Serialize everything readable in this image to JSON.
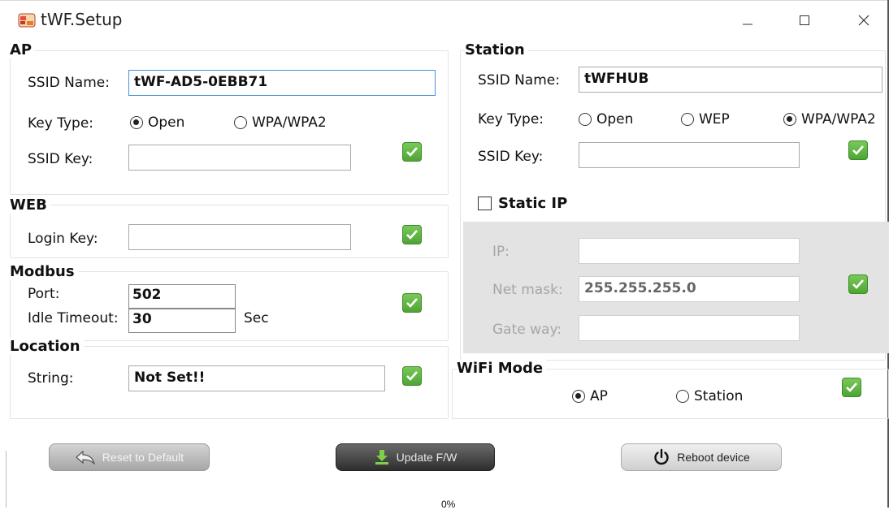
{
  "window": {
    "title": "tWF.Setup"
  },
  "ap": {
    "title": "AP",
    "ssid_name_label": "SSID Name:",
    "ssid_name_value": "tWF-AD5-0EBB71",
    "key_type_label": "Key Type:",
    "key_type_options": [
      "Open",
      "WPA/WPA2"
    ],
    "key_type_selected": "Open",
    "ssid_key_label": "SSID Key:",
    "ssid_key_value": ""
  },
  "web": {
    "title": "WEB",
    "login_key_label": "Login Key:",
    "login_key_value": ""
  },
  "modbus": {
    "title": "Modbus",
    "port_label": "Port:",
    "port_value": "502",
    "idle_label": "Idle Timeout:",
    "idle_value": "30",
    "idle_unit": "Sec"
  },
  "location": {
    "title": "Location",
    "string_label": "String:",
    "string_value": "Not Set!!"
  },
  "station": {
    "title": "Station",
    "ssid_name_label": "SSID Name:",
    "ssid_name_value": "tWFHUB",
    "key_type_label": "Key Type:",
    "key_type_options": [
      "Open",
      "WEP",
      "WPA/WPA2"
    ],
    "key_type_selected": "WPA/WPA2",
    "ssid_key_label": "SSID Key:",
    "ssid_key_value": "",
    "static_ip_label": "Static IP",
    "static_ip_checked": false,
    "ip_label": "IP:",
    "ip_value": "",
    "netmask_label": "Net mask:",
    "netmask_value": "255.255.255.0",
    "gateway_label": "Gate way:",
    "gateway_value": ""
  },
  "wifi_mode": {
    "title": "WiFi Mode",
    "options": [
      "AP",
      "Station"
    ],
    "selected": "AP"
  },
  "buttons": {
    "reset": "Reset to Default",
    "update": "Update F/W",
    "reboot": "Reboot device"
  },
  "progress": {
    "text": "0%",
    "value": 0
  },
  "colors": {
    "check_green": "#5bb43c",
    "panel_gray": "#e3e3e3",
    "focus_blue": "#4a90d9"
  }
}
